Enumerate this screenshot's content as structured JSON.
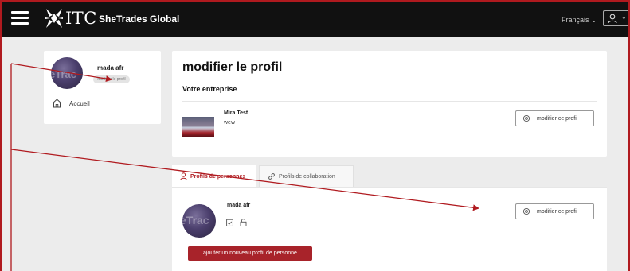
{
  "header": {
    "logo_text": "ITC",
    "brand": "SheTrades Global",
    "language": "Français"
  },
  "sidebar": {
    "user_name": "mada afr",
    "edit_profile_label": "modifier le profil",
    "nav_home": "Accueil"
  },
  "main": {
    "page_title": "modifier le profil",
    "section_title": "Votre entreprise",
    "business": {
      "name": "Mira Test",
      "subtitle": "wew",
      "edit_label": "modifier ce profil"
    }
  },
  "tabs": [
    {
      "label": "Profils de personnes",
      "active": true
    },
    {
      "label": "Profils de collaboration",
      "active": false
    }
  ],
  "person": {
    "name": "mada afr",
    "edit_label": "modifier ce profil",
    "add_button": "ajouter un nouveau profil de personne"
  },
  "avatar_ghost_text": "eTrac",
  "colors": {
    "brand_red": "#a8232a",
    "active_tab": "#b01a1f",
    "header_bg": "#111111",
    "page_bg": "#ececec",
    "annotation": "#b01a1f"
  },
  "icons": [
    "menu-icon",
    "itc-logo-icon",
    "chevron-down-icon",
    "user-icon",
    "home-icon",
    "gear-icon",
    "person-icon",
    "link-icon",
    "calendar-check-icon",
    "lock-icon"
  ]
}
